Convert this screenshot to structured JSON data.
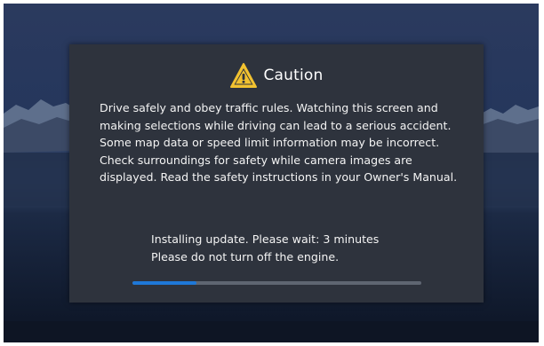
{
  "dialog": {
    "icon": "warning-triangle-icon",
    "title": "Caution",
    "message": "Drive safely and obey traffic rules. Watching this screen and making selections while driving can lead to a serious accident. Some map data or speed limit information may be incorrect. Check surroundings for safety while camera images are displayed. Read the safety instructions in your Owner's Manual.",
    "status_line1": "Installing update. Please wait: 3 minutes",
    "status_line2": "Please do not turn off the engine.",
    "progress": 0.22
  },
  "colors": {
    "accent": "#1e78d8",
    "warning": "#f2c230",
    "dialog_bg": "#2e333d"
  }
}
